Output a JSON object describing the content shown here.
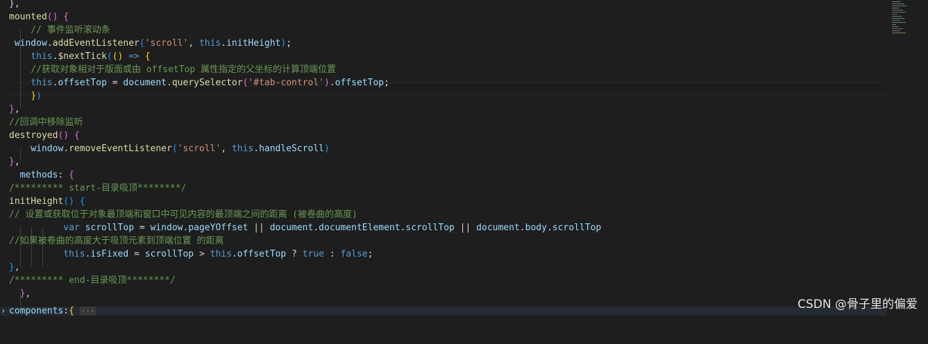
{
  "editor": {
    "lines": [
      {
        "tokens": [
          [
            "},",
            "punc"
          ]
        ]
      },
      {
        "tokens": [
          [
            "mounted",
            "fn"
          ],
          [
            "()",
            "b2"
          ],
          [
            " ",
            "punc"
          ],
          [
            "{",
            "b2"
          ]
        ]
      },
      {
        "tokens": [
          [
            "    // 事件监听滚动条",
            "cmt"
          ]
        ]
      },
      {
        "tokens": [
          [
            " window",
            "var"
          ],
          [
            ".",
            "punc"
          ],
          [
            "addEventListener",
            "fn"
          ],
          [
            "(",
            "b3"
          ],
          [
            "'scroll'",
            "str"
          ],
          [
            ", ",
            "punc"
          ],
          [
            "this",
            "kw"
          ],
          [
            ".",
            "punc"
          ],
          [
            "initHeight",
            "var"
          ],
          [
            ")",
            "b3"
          ],
          [
            ";",
            "punc"
          ]
        ]
      },
      {
        "tokens": [
          [
            "    this",
            "kw"
          ],
          [
            ".",
            "punc"
          ],
          [
            "$nextTick",
            "fn"
          ],
          [
            "(",
            "b3"
          ],
          [
            "()",
            "b1"
          ],
          [
            " ",
            "punc"
          ],
          [
            "=>",
            "kw"
          ],
          [
            " ",
            "punc"
          ],
          [
            "{",
            "b1"
          ]
        ]
      },
      {
        "tokens": [
          [
            "    //获取对象相对于版面或由 offsetTop 属性指定的父坐标的计算顶端位置",
            "cmt"
          ]
        ]
      },
      {
        "tokens": [
          [
            "    this",
            "kw"
          ],
          [
            ".",
            "punc"
          ],
          [
            "offsetTop",
            "var"
          ],
          [
            " = ",
            "op"
          ],
          [
            "document",
            "var"
          ],
          [
            ".",
            "punc"
          ],
          [
            "querySelector",
            "fn"
          ],
          [
            "(",
            "b2"
          ],
          [
            "'#tab-control'",
            "str"
          ],
          [
            ")",
            "b2"
          ],
          [
            ".",
            "punc"
          ],
          [
            "offsetTop",
            "var"
          ],
          [
            ";",
            "punc"
          ]
        ]
      },
      {
        "tokens": [
          [
            "    ",
            "punc"
          ],
          [
            "}",
            "b1"
          ],
          [
            ")",
            "b3"
          ]
        ]
      },
      {
        "tokens": [
          [
            "}",
            "b2"
          ],
          [
            ",",
            "punc"
          ]
        ]
      },
      {
        "tokens": [
          [
            "//回调中移除监听",
            "cmt"
          ]
        ]
      },
      {
        "tokens": [
          [
            "destroyed",
            "fn"
          ],
          [
            "()",
            "b2"
          ],
          [
            " ",
            "punc"
          ],
          [
            "{",
            "b2"
          ]
        ]
      },
      {
        "tokens": [
          [
            "    window",
            "var"
          ],
          [
            ".",
            "punc"
          ],
          [
            "removeEventListener",
            "fn"
          ],
          [
            "(",
            "b3"
          ],
          [
            "'scroll'",
            "str"
          ],
          [
            ", ",
            "punc"
          ],
          [
            "this",
            "kw"
          ],
          [
            ".",
            "punc"
          ],
          [
            "handleScroll",
            "var"
          ],
          [
            ")",
            "b3"
          ]
        ]
      },
      {
        "tokens": [
          [
            "}",
            "b2"
          ],
          [
            ",",
            "punc"
          ]
        ]
      },
      {
        "tokens": [
          [
            "  methods",
            "var"
          ],
          [
            ": ",
            "punc"
          ],
          [
            "{",
            "b2"
          ]
        ]
      },
      {
        "tokens": [
          [
            "/********* start-目录吸顶********/",
            "cmt"
          ]
        ]
      },
      {
        "tokens": [
          [
            "initHeight",
            "fn"
          ],
          [
            "()",
            "b3"
          ],
          [
            " ",
            "punc"
          ],
          [
            "{",
            "b3"
          ]
        ]
      },
      {
        "tokens": [
          [
            "// 设置或获取位于对象最顶端和窗口中可见内容的最顶端之间的距离 (被卷曲的高度)",
            "cmt"
          ]
        ]
      },
      {
        "tokens": [
          [
            "          var",
            "kw"
          ],
          [
            " ",
            "punc"
          ],
          [
            "scrollTop",
            "var"
          ],
          [
            " = ",
            "op"
          ],
          [
            "window",
            "var"
          ],
          [
            ".",
            "punc"
          ],
          [
            "pageYOffset",
            "var"
          ],
          [
            " || ",
            "op"
          ],
          [
            "document",
            "var"
          ],
          [
            ".",
            "punc"
          ],
          [
            "documentElement",
            "var"
          ],
          [
            ".",
            "punc"
          ],
          [
            "scrollTop",
            "var"
          ],
          [
            " || ",
            "op"
          ],
          [
            "document",
            "var"
          ],
          [
            ".",
            "punc"
          ],
          [
            "body",
            "var"
          ],
          [
            ".",
            "punc"
          ],
          [
            "scrollTop",
            "var"
          ]
        ]
      },
      {
        "tokens": [
          [
            "//如果被卷曲的高度大于吸顶元素到顶端位置 的距离",
            "cmt"
          ]
        ]
      },
      {
        "tokens": [
          [
            "          this",
            "kw"
          ],
          [
            ".",
            "punc"
          ],
          [
            "isFixed",
            "var"
          ],
          [
            " = ",
            "op"
          ],
          [
            "scrollTop",
            "var"
          ],
          [
            " > ",
            "op"
          ],
          [
            "this",
            "kw"
          ],
          [
            ".",
            "punc"
          ],
          [
            "offsetTop",
            "var"
          ],
          [
            " ? ",
            "op"
          ],
          [
            "true",
            "kw"
          ],
          [
            " : ",
            "op"
          ],
          [
            "false",
            "kw"
          ],
          [
            ";",
            "punc"
          ]
        ]
      },
      {
        "tokens": [
          [
            "}",
            "b3"
          ],
          [
            ",",
            "punc"
          ]
        ]
      },
      {
        "tokens": [
          [
            "/********* end-目录吸顶********/",
            "cmt"
          ]
        ]
      },
      {
        "tokens": [
          [
            "  ",
            "punc"
          ],
          [
            "}",
            "b2"
          ],
          [
            ",",
            "punc"
          ]
        ]
      }
    ],
    "folded_line": {
      "text": "components",
      "colon": ":",
      "brace": "{",
      "ellipsis": "···"
    }
  },
  "watermark": "CSDN @骨子里的偏爱",
  "colors": {
    "background": "#1e1e1e",
    "keyword": "#569cd6",
    "function": "#dcdcaa",
    "variable": "#9cdcfe",
    "string": "#ce9178",
    "comment": "#6a9955"
  }
}
